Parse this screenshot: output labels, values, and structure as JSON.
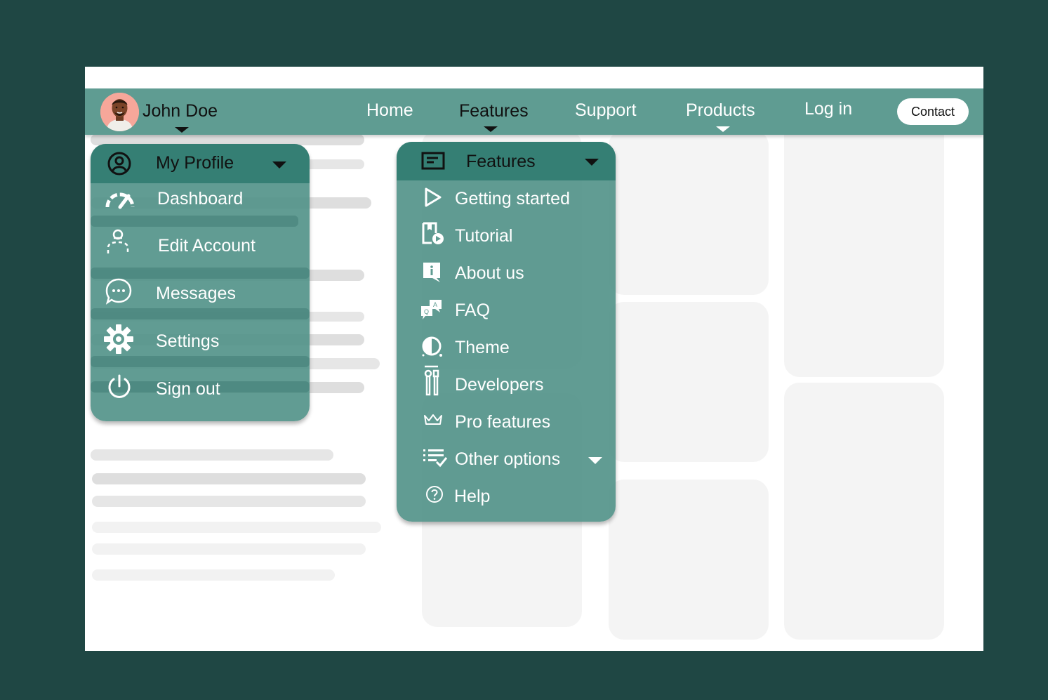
{
  "user": {
    "name": "John Doe"
  },
  "nav": {
    "links": [
      {
        "label": "Home"
      },
      {
        "label": "Features"
      },
      {
        "label": "Support"
      },
      {
        "label": "Products"
      },
      {
        "label": "Log in"
      }
    ],
    "contact_label": "Contact"
  },
  "profile_menu": {
    "title": "My Profile",
    "items": [
      {
        "label": "Dashboard",
        "icon": "gauge-icon"
      },
      {
        "label": "Edit Account",
        "icon": "user-icon"
      },
      {
        "label": "Messages",
        "icon": "chat-bubble-icon"
      },
      {
        "label": "Settings",
        "icon": "gear-icon"
      },
      {
        "label": "Sign out",
        "icon": "power-icon"
      }
    ]
  },
  "features_menu": {
    "title": "Features",
    "items": [
      {
        "label": "Getting started",
        "icon": "play-icon"
      },
      {
        "label": "Tutorial",
        "icon": "tutorial-icon"
      },
      {
        "label": "About us",
        "icon": "info-icon"
      },
      {
        "label": "FAQ",
        "icon": "faq-icon"
      },
      {
        "label": "Theme",
        "icon": "theme-icon"
      },
      {
        "label": "Developers",
        "icon": "tools-icon"
      },
      {
        "label": "Pro features",
        "icon": "crown-icon"
      },
      {
        "label": "Other options",
        "icon": "checklist-icon"
      },
      {
        "label": "Help",
        "icon": "help-icon"
      }
    ]
  },
  "colors": {
    "page_bg": "#1f4744",
    "navbar": "#5f9c92",
    "menu_header": "#357f74",
    "menu_body": "#5f9c92"
  }
}
